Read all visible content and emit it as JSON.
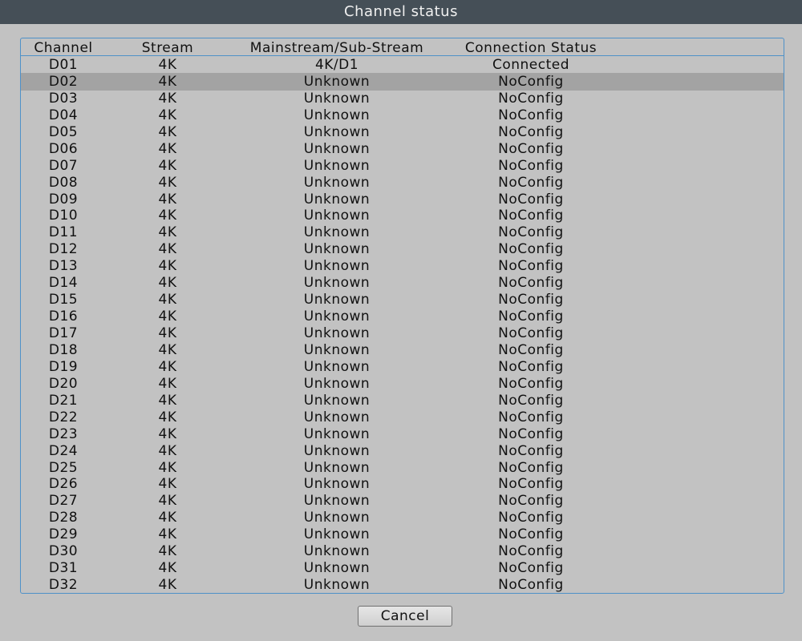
{
  "window": {
    "title": "Channel status"
  },
  "table": {
    "headers": {
      "channel": "Channel",
      "stream": "Stream",
      "sub_stream": "Mainstream/Sub-Stream",
      "status": "Connection Status"
    },
    "selected_channel": "D02",
    "rows": [
      {
        "channel": "D01",
        "stream": "4K",
        "sub_stream": "4K/D1",
        "status": "Connected"
      },
      {
        "channel": "D02",
        "stream": "4K",
        "sub_stream": "Unknown",
        "status": "NoConfig"
      },
      {
        "channel": "D03",
        "stream": "4K",
        "sub_stream": "Unknown",
        "status": "NoConfig"
      },
      {
        "channel": "D04",
        "stream": "4K",
        "sub_stream": "Unknown",
        "status": "NoConfig"
      },
      {
        "channel": "D05",
        "stream": "4K",
        "sub_stream": "Unknown",
        "status": "NoConfig"
      },
      {
        "channel": "D06",
        "stream": "4K",
        "sub_stream": "Unknown",
        "status": "NoConfig"
      },
      {
        "channel": "D07",
        "stream": "4K",
        "sub_stream": "Unknown",
        "status": "NoConfig"
      },
      {
        "channel": "D08",
        "stream": "4K",
        "sub_stream": "Unknown",
        "status": "NoConfig"
      },
      {
        "channel": "D09",
        "stream": "4K",
        "sub_stream": "Unknown",
        "status": "NoConfig"
      },
      {
        "channel": "D10",
        "stream": "4K",
        "sub_stream": "Unknown",
        "status": "NoConfig"
      },
      {
        "channel": "D11",
        "stream": "4K",
        "sub_stream": "Unknown",
        "status": "NoConfig"
      },
      {
        "channel": "D12",
        "stream": "4K",
        "sub_stream": "Unknown",
        "status": "NoConfig"
      },
      {
        "channel": "D13",
        "stream": "4K",
        "sub_stream": "Unknown",
        "status": "NoConfig"
      },
      {
        "channel": "D14",
        "stream": "4K",
        "sub_stream": "Unknown",
        "status": "NoConfig"
      },
      {
        "channel": "D15",
        "stream": "4K",
        "sub_stream": "Unknown",
        "status": "NoConfig"
      },
      {
        "channel": "D16",
        "stream": "4K",
        "sub_stream": "Unknown",
        "status": "NoConfig"
      },
      {
        "channel": "D17",
        "stream": "4K",
        "sub_stream": "Unknown",
        "status": "NoConfig"
      },
      {
        "channel": "D18",
        "stream": "4K",
        "sub_stream": "Unknown",
        "status": "NoConfig"
      },
      {
        "channel": "D19",
        "stream": "4K",
        "sub_stream": "Unknown",
        "status": "NoConfig"
      },
      {
        "channel": "D20",
        "stream": "4K",
        "sub_stream": "Unknown",
        "status": "NoConfig"
      },
      {
        "channel": "D21",
        "stream": "4K",
        "sub_stream": "Unknown",
        "status": "NoConfig"
      },
      {
        "channel": "D22",
        "stream": "4K",
        "sub_stream": "Unknown",
        "status": "NoConfig"
      },
      {
        "channel": "D23",
        "stream": "4K",
        "sub_stream": "Unknown",
        "status": "NoConfig"
      },
      {
        "channel": "D24",
        "stream": "4K",
        "sub_stream": "Unknown",
        "status": "NoConfig"
      },
      {
        "channel": "D25",
        "stream": "4K",
        "sub_stream": "Unknown",
        "status": "NoConfig"
      },
      {
        "channel": "D26",
        "stream": "4K",
        "sub_stream": "Unknown",
        "status": "NoConfig"
      },
      {
        "channel": "D27",
        "stream": "4K",
        "sub_stream": "Unknown",
        "status": "NoConfig"
      },
      {
        "channel": "D28",
        "stream": "4K",
        "sub_stream": "Unknown",
        "status": "NoConfig"
      },
      {
        "channel": "D29",
        "stream": "4K",
        "sub_stream": "Unknown",
        "status": "NoConfig"
      },
      {
        "channel": "D30",
        "stream": "4K",
        "sub_stream": "Unknown",
        "status": "NoConfig"
      },
      {
        "channel": "D31",
        "stream": "4K",
        "sub_stream": "Unknown",
        "status": "NoConfig"
      },
      {
        "channel": "D32",
        "stream": "4K",
        "sub_stream": "Unknown",
        "status": "NoConfig"
      }
    ]
  },
  "footer": {
    "cancel_label": "Cancel"
  },
  "colors": {
    "titlebar": "#454f57",
    "background": "#c2c2c2",
    "selected_row": "#a3a3a3",
    "table_border": "#4e91c8"
  }
}
